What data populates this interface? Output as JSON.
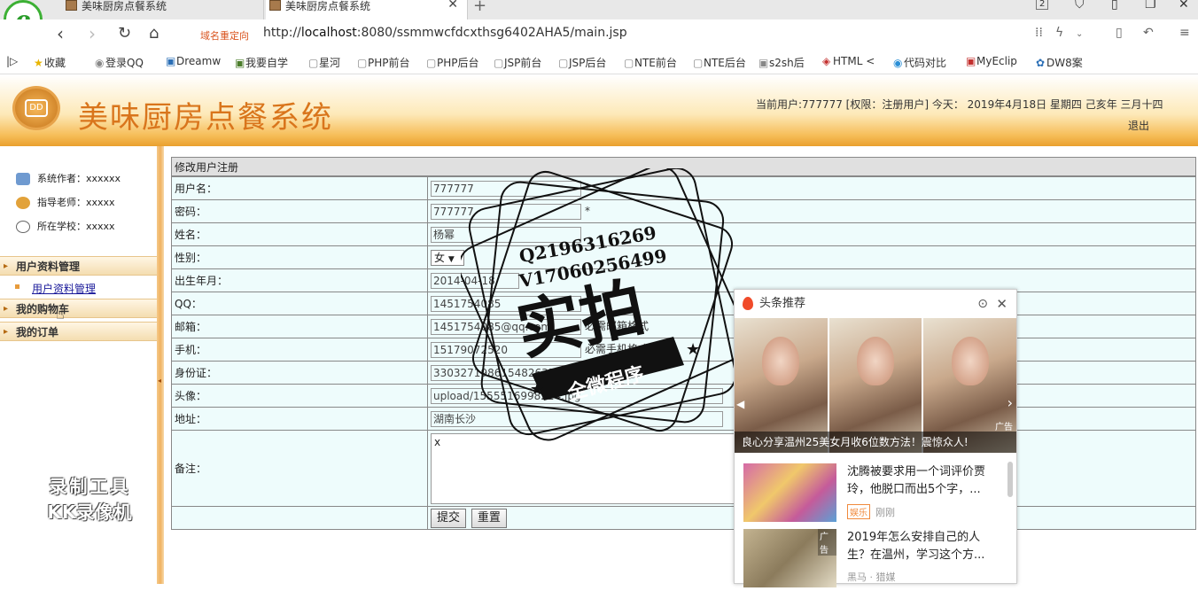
{
  "browser": {
    "tabs": [
      {
        "label": "美味厨房点餐系统",
        "active": false
      },
      {
        "label": "美味厨房点餐系统",
        "active": true
      }
    ],
    "tab_count": "2",
    "redirect_label": "域名重定向",
    "url_prefix": "http://",
    "url_host": "localhost",
    "url_rest": ":8080/ssmmwcfdcxthsg6402AHA5/main.jsp",
    "bookmarks": [
      "收藏",
      "登录QQ",
      "Dreamw",
      "我要自学",
      "星河",
      "PHP前台",
      "PHP后台",
      "JSP前台",
      "JSP后台",
      "NTE前台",
      "NTE后台",
      "s2sh后",
      "HTML <",
      "代码对比",
      "MyEclip",
      "DW8案"
    ]
  },
  "header": {
    "title": "美味厨房点餐系统",
    "user_info": "当前用户:777777 [权限：注册用户] 今天： 2019年4月18日 星期四 己亥年 三月十四",
    "logout": "退出"
  },
  "sidebar": {
    "info": [
      {
        "label": "系统作者：xxxxxx",
        "icon": "author-icon"
      },
      {
        "label": "指导老师：xxxxx",
        "icon": "teacher-icon"
      },
      {
        "label": "所在学校：xxxxx",
        "icon": "school-icon"
      }
    ],
    "menu": [
      {
        "label": "用户资料管理",
        "sub": [
          "用户资料管理"
        ]
      },
      {
        "label": "我的购物车",
        "sub": []
      },
      {
        "label": "我的订单",
        "sub": []
      }
    ],
    "recorder_line1": "录制工具",
    "recorder_line2": "KK录像机"
  },
  "form": {
    "title": "修改用户注册",
    "fields": {
      "username": {
        "label": "用户名：",
        "value": "777777",
        "mark": "*"
      },
      "password": {
        "label": "密码：",
        "value": "777777",
        "mark": "*"
      },
      "name": {
        "label": "姓名：",
        "value": "杨幂"
      },
      "gender": {
        "label": "性别：",
        "value": "女"
      },
      "birth": {
        "label": "出生年月：",
        "value": "2014-04-18"
      },
      "qq": {
        "label": "QQ：",
        "value": "1451754085"
      },
      "email": {
        "label": "邮箱：",
        "value": "1451754085@qq.com",
        "hint": "必需邮箱格式"
      },
      "phone": {
        "label": "手机：",
        "value": "15179072520",
        "hint": "必需手机格式"
      },
      "idcard": {
        "label": "身份证：",
        "value": "330327198615482635"
      },
      "avatar": {
        "label": "头像：",
        "value": "upload/1555516998224.jpg"
      },
      "address": {
        "label": "地址：",
        "value": "湖南长沙"
      },
      "note": {
        "label": "备注：",
        "value": "x"
      }
    },
    "submit": "提交",
    "reset": "重置"
  },
  "stamp": {
    "q_line": "Q2196316269",
    "v_line": "V17060256499",
    "big": "实拍",
    "ribbon": "全微程序"
  },
  "popup": {
    "title": "头条推荐",
    "gallery_caption": "良心分享温州25美女月收6位数方法！震惊众人!",
    "gallery_ad": "广告",
    "news": [
      {
        "text": "沈腾被要求用一个词评价贾玲，他脱口而出5个字，...",
        "badge": "娱乐",
        "meta": "刚刚"
      },
      {
        "text": "2019年怎么安排自己的人生？在温州，学习这个方...",
        "ad": "广告",
        "meta": "黑马 · 猎媒"
      }
    ]
  }
}
